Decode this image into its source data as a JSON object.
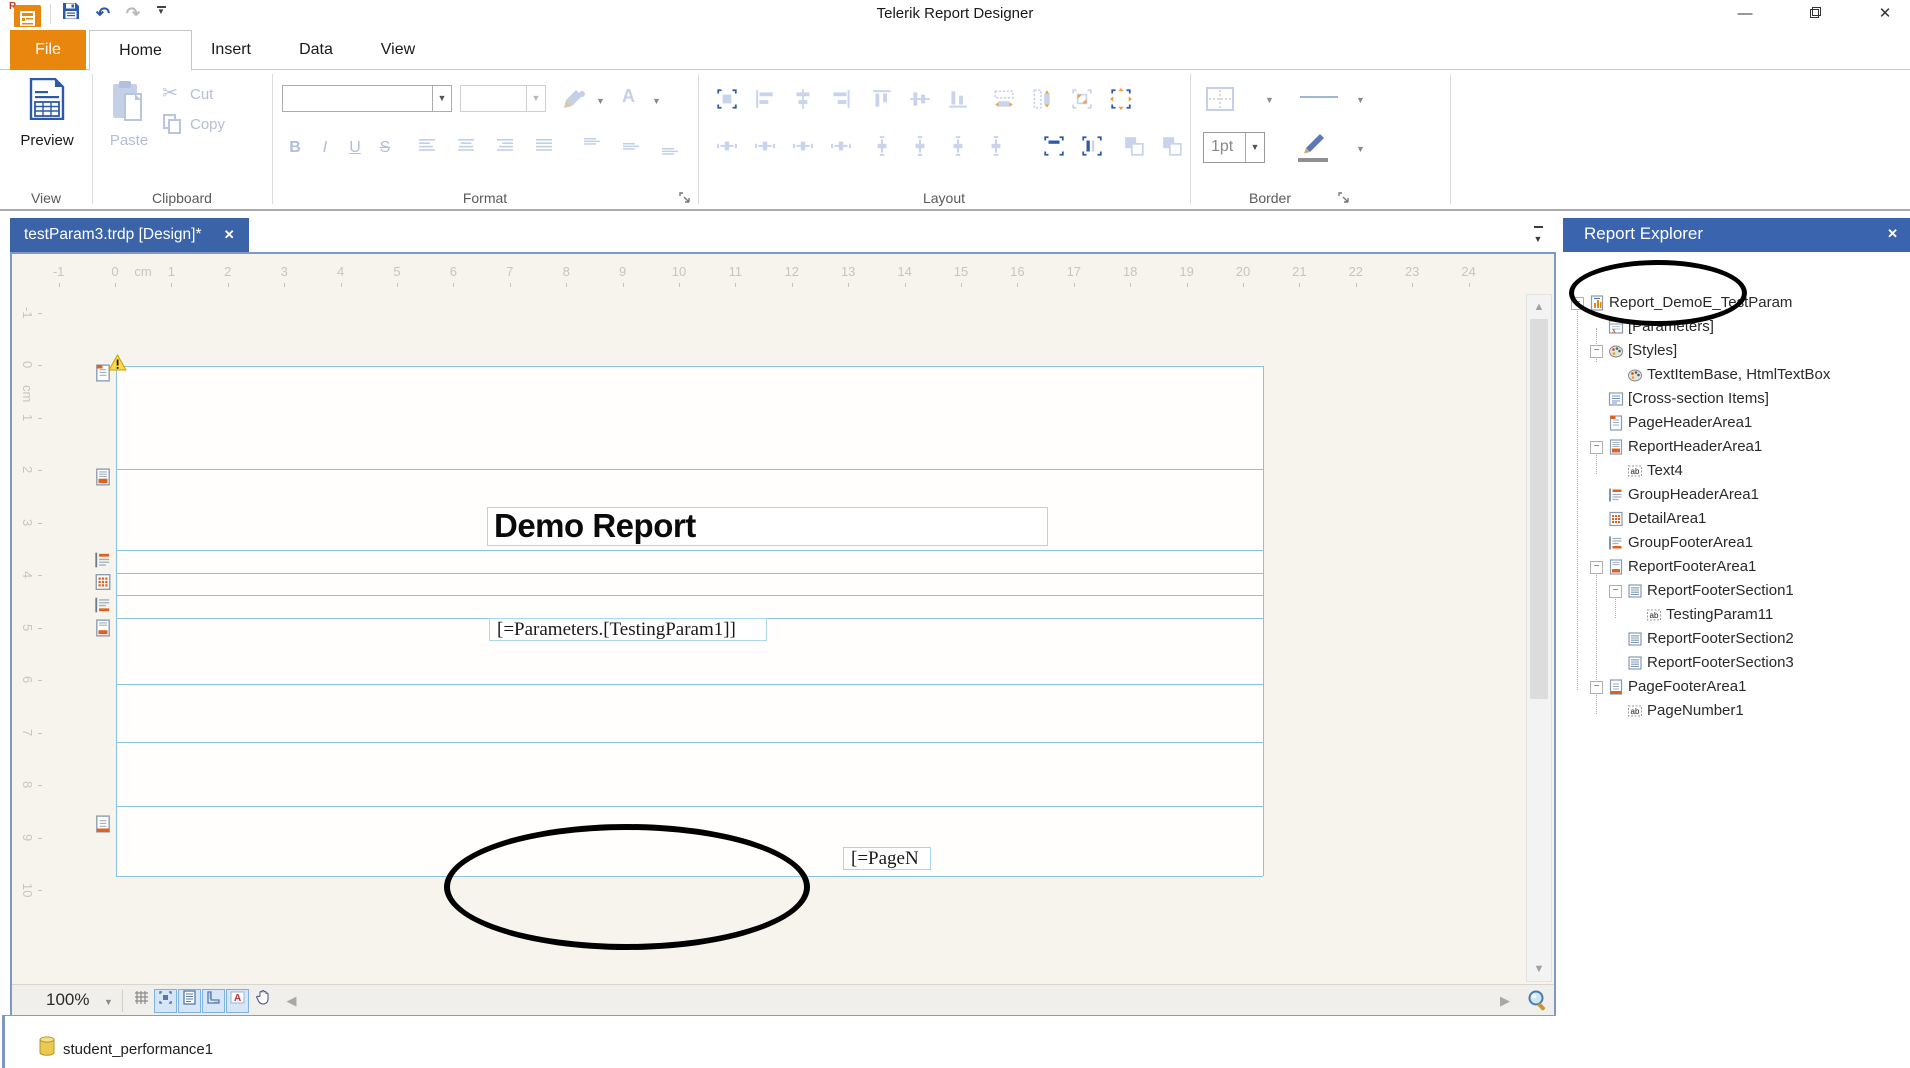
{
  "title_bar": {
    "title": "Telerik Report Designer"
  },
  "quick_access": {
    "icons": [
      "app-logo",
      "save",
      "undo",
      "redo",
      "customize-quick-access"
    ]
  },
  "window_controls": {
    "minimize": "—",
    "close": "✕"
  },
  "ribbon": {
    "tabs": {
      "file": "File",
      "home": "Home",
      "insert": "Insert",
      "data": "Data",
      "view": "View"
    },
    "groups": {
      "view": {
        "label": "View",
        "preview": "Preview"
      },
      "clipboard": {
        "label": "Clipboard",
        "paste": "Paste",
        "cut": "Cut",
        "copy": "Copy"
      },
      "format": {
        "label": "Format",
        "style_buttons": [
          "B",
          "I",
          "U",
          "S"
        ],
        "align_icons": [
          "align-text-left",
          "align-text-center",
          "align-text-right",
          "align-text-justify"
        ],
        "valign_icons": [
          "align-text-top",
          "align-text-middle",
          "align-text-bottom"
        ],
        "color_icons": [
          "highlight-color-icon",
          "font-color-icon"
        ]
      },
      "layout": {
        "label": "Layout",
        "row1_icons": [
          {
            "name": "snap-to-grid",
            "state": "frame-blue"
          },
          {
            "name": "align-lefts",
            "state": "bars-left"
          },
          {
            "name": "align-centers",
            "state": "bars-center"
          },
          {
            "name": "align-rights",
            "state": "bars-right"
          },
          {
            "name": "align-tops",
            "state": "vbars-top"
          },
          {
            "name": "align-middles",
            "state": "vbars-middle"
          },
          {
            "name": "align-bottoms",
            "state": "vbars-bottom"
          },
          {
            "name": "same-width",
            "state": "size-orange"
          },
          {
            "name": "same-height",
            "state": "size-orange-v"
          },
          {
            "name": "same-size",
            "state": "size-orange-b"
          },
          {
            "name": "center-in-form",
            "state": "frame-orange"
          }
        ],
        "row2_icons": [
          {
            "name": "space-horizontally-equal",
            "state": "spread-h"
          },
          {
            "name": "space-horizontally-increase",
            "state": "spread-h"
          },
          {
            "name": "space-horizontally-decrease",
            "state": "spread-h"
          },
          {
            "name": "space-horizontally-remove",
            "state": "spread-h"
          },
          {
            "name": "space-vertically-equal",
            "state": "spread-v"
          },
          {
            "name": "space-vertically-increase",
            "state": "spread-v"
          },
          {
            "name": "space-vertically-decrease",
            "state": "spread-v"
          },
          {
            "name": "space-vertically-remove",
            "state": "spread-v"
          },
          {
            "name": "align-top-edge",
            "state": "frame-dark"
          },
          {
            "name": "align-left-edge",
            "state": "frame-dark-v"
          },
          {
            "name": "bring-to-front",
            "state": "layer"
          },
          {
            "name": "send-to-back",
            "state": "layer"
          }
        ]
      },
      "border": {
        "label": "Border",
        "width_value": "1pt",
        "icons": [
          "border-style-icon",
          "line-style-icon",
          "line-color-icon"
        ]
      }
    }
  },
  "document_tab": {
    "label": "testParam3.trdp [Design]*",
    "close": "✕"
  },
  "ruler": {
    "horizontal": [
      "-1",
      "0",
      "cm",
      "1",
      "2",
      "3",
      "4",
      "5",
      "6",
      "7",
      "8",
      "9",
      "10",
      "11",
      "12",
      "13",
      "14",
      "15",
      "16",
      "17",
      "18",
      "19",
      "20",
      "21",
      "22",
      "23",
      "24"
    ],
    "vertical": [
      "-1",
      "0",
      "cm",
      "1",
      "2",
      "3",
      "4",
      "5",
      "6",
      "7",
      "8",
      "9",
      "10"
    ]
  },
  "report_design": {
    "title_text": "Demo Report",
    "parameter_expression": "[=Parameters.[TestingParam1]]",
    "page_number_expression": "[=PageN",
    "section_markers": [
      "page-header-warning",
      "report-header",
      "group-header",
      "detail",
      "group-footer",
      "report-footer",
      "page-footer"
    ]
  },
  "status_bar": {
    "zoom": "100%",
    "left_icons": [
      {
        "name": "grid-toggle",
        "active": false
      },
      {
        "name": "snap-to-grid-toggle",
        "active": true
      },
      {
        "name": "page-breaks-toggle",
        "active": true
      },
      {
        "name": "ruler-toggle",
        "active": true
      },
      {
        "name": "text-markers-toggle",
        "active": true
      },
      {
        "name": "pan-tool",
        "active": false
      },
      {
        "name": "scroll-left",
        "active": false
      }
    ],
    "right_icons": [
      "scroll-right",
      "zoom-tool"
    ]
  },
  "data_explorer": {
    "items": [
      {
        "label": "student_performance1",
        "icon": "database"
      }
    ]
  },
  "report_explorer": {
    "title": "Report Explorer",
    "close": "✕",
    "tree": [
      {
        "label": "Report_DemoE_TestParam",
        "icon": "report",
        "level": 0,
        "expander": "minus"
      },
      {
        "label": "[Parameters]",
        "icon": "parameters",
        "level": 1,
        "circled": true
      },
      {
        "label": "[Styles]",
        "icon": "styles",
        "level": 1,
        "expander": "minus"
      },
      {
        "label": "TextItemBase, HtmlTextBox",
        "icon": "styles",
        "level": 2
      },
      {
        "label": "[Cross-section Items]",
        "icon": "cross-section",
        "level": 1
      },
      {
        "label": "PageHeaderArea1",
        "icon": "page-header",
        "level": 1
      },
      {
        "label": "ReportHeaderArea1",
        "icon": "report-header",
        "level": 1,
        "expander": "minus"
      },
      {
        "label": "Text4",
        "icon": "ab",
        "level": 2
      },
      {
        "label": "GroupHeaderArea1",
        "icon": "group-header",
        "level": 1
      },
      {
        "label": "DetailArea1",
        "icon": "detail",
        "level": 1
      },
      {
        "label": "GroupFooterArea1",
        "icon": "group-footer",
        "level": 1
      },
      {
        "label": "ReportFooterArea1",
        "icon": "report-footer",
        "level": 1,
        "expander": "minus"
      },
      {
        "label": "ReportFooterSection1",
        "icon": "section-plain",
        "level": 2,
        "expander": "minus"
      },
      {
        "label": "TestingParam11",
        "icon": "ab",
        "level": 3
      },
      {
        "label": "ReportFooterSection2",
        "icon": "section-plain",
        "level": 2
      },
      {
        "label": "ReportFooterSection3",
        "icon": "section-plain",
        "level": 2
      },
      {
        "label": "PageFooterArea1",
        "icon": "page-footer",
        "level": 1,
        "expander": "minus"
      },
      {
        "label": "PageNumber1",
        "icon": "ab",
        "level": 2
      }
    ]
  }
}
